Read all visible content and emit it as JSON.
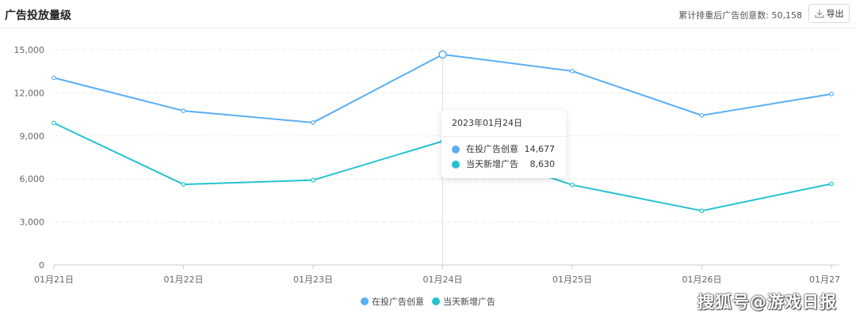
{
  "header": {
    "title": "广告投放量级",
    "summary": "累计排重后广告创意数: 50,158",
    "export_label": "导出"
  },
  "tooltip": {
    "date": "2023年01月24日",
    "rows": [
      {
        "name": "在投广告创意",
        "value": "14,677",
        "color": "#5aaef3"
      },
      {
        "name": "当天新增广告",
        "value": "8,630",
        "color": "#26c2d0"
      }
    ]
  },
  "chart_data": {
    "type": "line",
    "title": "",
    "xlabel": "",
    "ylabel": "",
    "categories": [
      "01月21日",
      "01月22日",
      "01月23日",
      "01月24日",
      "01月25日",
      "01月26日",
      "01月27"
    ],
    "series": [
      {
        "name": "在投广告创意",
        "color": "#5aaef3",
        "values": [
          13050,
          10750,
          9930,
          14677,
          13520,
          10430,
          11920
        ]
      },
      {
        "name": "当天新增广告",
        "color": "#26c2d0",
        "values": [
          9900,
          5620,
          5920,
          8630,
          5580,
          3780,
          5660
        ]
      }
    ],
    "yticks": [
      "0",
      "3,000",
      "6,000",
      "9,000",
      "12,000",
      "15,000"
    ],
    "ylim": [
      0,
      15000
    ],
    "grid": true,
    "legend": "bottom-center",
    "highlight_index": 3
  },
  "watermark": "搜狐号@游戏日报",
  "icons": {
    "export": "download-icon"
  }
}
